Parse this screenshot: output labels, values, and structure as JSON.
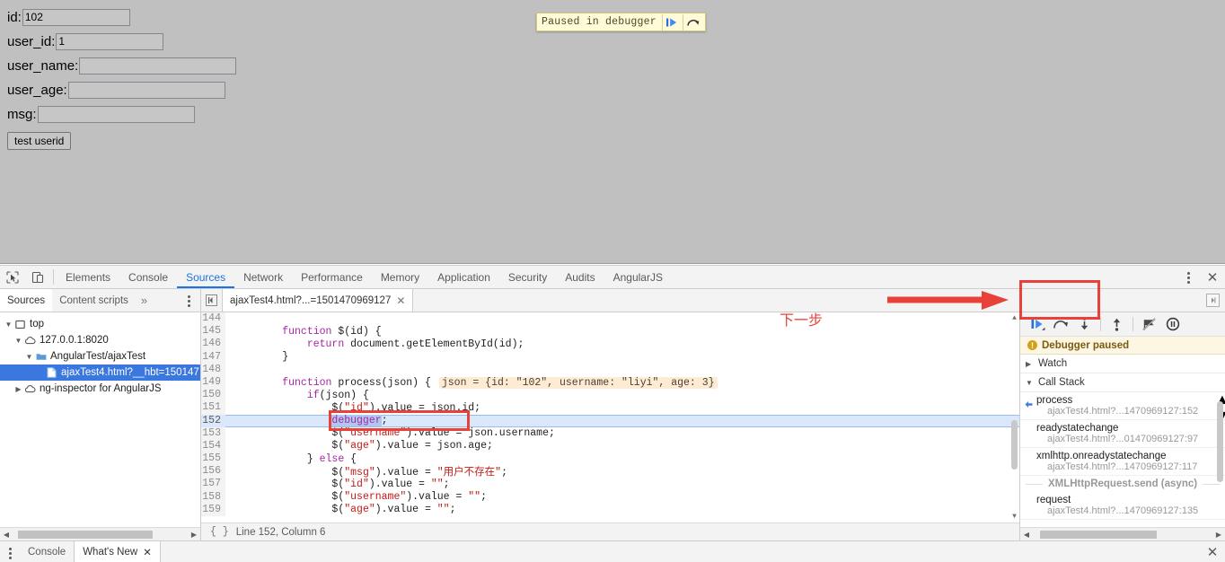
{
  "page": {
    "fields": [
      {
        "label": "id:",
        "value": "102",
        "name": "id-field",
        "width": "w-id"
      },
      {
        "label": "user_id:",
        "value": "1",
        "name": "user-id-field",
        "width": "w-uid"
      },
      {
        "label": "user_name:",
        "value": "",
        "name": "user-name-field",
        "width": "w-uname"
      },
      {
        "label": "user_age:",
        "value": "",
        "name": "user-age-field",
        "width": "w-uage"
      },
      {
        "label": "msg:",
        "value": "",
        "name": "msg-field",
        "width": "w-msg"
      }
    ],
    "test_button": "test userid",
    "pause_banner": {
      "text": "Paused in debugger",
      "resume_icon": "resume-play-icon",
      "step_over_icon": "step-over-icon"
    }
  },
  "devtools": {
    "toolbar": {
      "inspect_icon": "inspect-element-icon",
      "device_icon": "device-toolbar-icon",
      "tabs": [
        {
          "label": "Elements",
          "active": false
        },
        {
          "label": "Console",
          "active": false
        },
        {
          "label": "Sources",
          "active": true
        },
        {
          "label": "Network",
          "active": false
        },
        {
          "label": "Performance",
          "active": false
        },
        {
          "label": "Memory",
          "active": false
        },
        {
          "label": "Application",
          "active": false
        },
        {
          "label": "Security",
          "active": false
        },
        {
          "label": "Audits",
          "active": false
        },
        {
          "label": "AngularJS",
          "active": false
        }
      ],
      "kebab_icon": "more-options-icon",
      "close_icon": "close-devtools-icon"
    },
    "sources_subbar": {
      "nav_tabs": [
        {
          "label": "Sources",
          "active": true
        },
        {
          "label": "Content scripts",
          "active": false
        }
      ],
      "more_tabs_icon": "more-tabs-chevron-icon",
      "nav_kebab_icon": "navigator-more-options-icon",
      "sidebar_toggle_icon": "show-navigator-icon",
      "file_tab": "ajaxTest4.html?...=1501470969127",
      "file_tab_close_icon": "close-tab-icon",
      "expand_sidebar_icon": "expand-debugger-sidebar-icon"
    },
    "navigator": {
      "tree": [
        {
          "indent": 0,
          "twisty": "▼",
          "icon": "frame-icon",
          "label": "top",
          "selected": false
        },
        {
          "indent": 1,
          "twisty": "▼",
          "icon": "cloud-icon",
          "label": "127.0.0.1:8020",
          "selected": false
        },
        {
          "indent": 2,
          "twisty": "▼",
          "icon": "folder-icon",
          "label": "AngularTest/ajaxTest",
          "selected": false
        },
        {
          "indent": 3,
          "twisty": "",
          "icon": "file-icon",
          "label": "ajaxTest4.html?__hbt=150147",
          "selected": true
        },
        {
          "indent": 1,
          "twisty": "▶",
          "icon": "cloud-icon",
          "label": "ng-inspector for AngularJS",
          "selected": false
        }
      ]
    },
    "editor": {
      "lines": [
        {
          "num": "144",
          "exec": false,
          "tokens": []
        },
        {
          "num": "145",
          "exec": false,
          "tokens": [
            {
              "t": "        ",
              "c": ""
            },
            {
              "t": "function",
              "c": "kw"
            },
            {
              "t": " $(id) {",
              "c": ""
            }
          ]
        },
        {
          "num": "146",
          "exec": false,
          "tokens": [
            {
              "t": "            ",
              "c": ""
            },
            {
              "t": "return",
              "c": "kw"
            },
            {
              "t": " document.getElementById(id);",
              "c": ""
            }
          ]
        },
        {
          "num": "147",
          "exec": false,
          "tokens": [
            {
              "t": "        }",
              "c": ""
            }
          ]
        },
        {
          "num": "148",
          "exec": false,
          "tokens": []
        },
        {
          "num": "149",
          "exec": false,
          "tokens": [
            {
              "t": "        ",
              "c": ""
            },
            {
              "t": "function",
              "c": "kw"
            },
            {
              "t": " process(json) {",
              "c": ""
            }
          ],
          "hint": "json = {id: \"102\", username: \"liyi\", age: 3}"
        },
        {
          "num": "150",
          "exec": false,
          "tokens": [
            {
              "t": "            ",
              "c": ""
            },
            {
              "t": "if",
              "c": "kw"
            },
            {
              "t": "(json) {",
              "c": ""
            }
          ]
        },
        {
          "num": "151",
          "exec": false,
          "tokens": [
            {
              "t": "                $(",
              "c": ""
            },
            {
              "t": "\"id\"",
              "c": "str"
            },
            {
              "t": ").value = json.id;",
              "c": ""
            }
          ]
        },
        {
          "num": "152",
          "exec": true,
          "tokens": [
            {
              "t": "                ",
              "c": ""
            },
            {
              "t": "debugger",
              "c": "kw sel"
            },
            {
              "t": ";",
              "c": ""
            }
          ]
        },
        {
          "num": "153",
          "exec": false,
          "tokens": [
            {
              "t": "                $(",
              "c": ""
            },
            {
              "t": "\"username\"",
              "c": "str"
            },
            {
              "t": ").value = json.username;",
              "c": ""
            }
          ]
        },
        {
          "num": "154",
          "exec": false,
          "tokens": [
            {
              "t": "                $(",
              "c": ""
            },
            {
              "t": "\"age\"",
              "c": "str"
            },
            {
              "t": ").value = json.age;",
              "c": ""
            }
          ]
        },
        {
          "num": "155",
          "exec": false,
          "tokens": [
            {
              "t": "            } ",
              "c": ""
            },
            {
              "t": "else",
              "c": "kw"
            },
            {
              "t": " {",
              "c": ""
            }
          ]
        },
        {
          "num": "156",
          "exec": false,
          "tokens": [
            {
              "t": "                $(",
              "c": ""
            },
            {
              "t": "\"msg\"",
              "c": "str"
            },
            {
              "t": ").value = ",
              "c": ""
            },
            {
              "t": "\"用户不存在\"",
              "c": "str"
            },
            {
              "t": ";",
              "c": ""
            }
          ]
        },
        {
          "num": "157",
          "exec": false,
          "tokens": [
            {
              "t": "                $(",
              "c": ""
            },
            {
              "t": "\"id\"",
              "c": "str"
            },
            {
              "t": ").value = ",
              "c": ""
            },
            {
              "t": "\"\"",
              "c": "str"
            },
            {
              "t": ";",
              "c": ""
            }
          ]
        },
        {
          "num": "158",
          "exec": false,
          "tokens": [
            {
              "t": "                $(",
              "c": ""
            },
            {
              "t": "\"username\"",
              "c": "str"
            },
            {
              "t": ").value = ",
              "c": ""
            },
            {
              "t": "\"\"",
              "c": "str"
            },
            {
              "t": ";",
              "c": ""
            }
          ]
        },
        {
          "num": "159",
          "exec": false,
          "tokens": [
            {
              "t": "                $(",
              "c": ""
            },
            {
              "t": "\"age\"",
              "c": "str"
            },
            {
              "t": ").value = ",
              "c": ""
            },
            {
              "t": "\"\"",
              "c": "str"
            },
            {
              "t": ";",
              "c": ""
            }
          ]
        }
      ],
      "status": {
        "pretty_print_icon": "pretty-print-braces-icon",
        "position": "Line 152, Column 6"
      }
    },
    "debugger_pane": {
      "toolbar_buttons": [
        {
          "name": "resume-script-button",
          "icon": "resume-play-icon"
        },
        {
          "name": "step-over-button",
          "icon": "step-over-icon"
        },
        {
          "name": "step-into-button",
          "icon": "step-into-icon"
        },
        {
          "name": "step-out-button",
          "icon": "step-out-icon"
        },
        {
          "name": "deactivate-breakpoints-button",
          "icon": "deactivate-breakpoints-icon"
        },
        {
          "name": "pause-on-exceptions-button",
          "icon": "pause-on-exceptions-icon"
        }
      ],
      "paused_message": "Debugger paused",
      "sections": [
        {
          "label": "Watch",
          "expanded": false,
          "twisty": "▶"
        },
        {
          "label": "Call Stack",
          "expanded": true,
          "twisty": "▼"
        }
      ],
      "call_stack": [
        {
          "name": "process",
          "location": "ajaxTest4.html?...1470969127:152",
          "current": true,
          "async": false
        },
        {
          "name": "readystatechange",
          "location": "ajaxTest4.html?...01470969127:97",
          "current": false,
          "async": false
        },
        {
          "name": "xmlhttp.onreadystatechange",
          "location": "ajaxTest4.html?...1470969127:117",
          "current": false,
          "async": false
        },
        {
          "name": "XMLHttpRequest.send (async)",
          "location": "",
          "current": false,
          "async": true
        },
        {
          "name": "request",
          "location": "ajaxTest4.html?...1470969127:135",
          "current": false,
          "async": false
        }
      ]
    },
    "drawer": {
      "kebab_icon": "drawer-more-options-icon",
      "tabs": [
        {
          "label": "Console",
          "active": false,
          "closable": false
        },
        {
          "label": "What's New",
          "active": true,
          "closable": true
        }
      ],
      "close_icon": "close-drawer-icon"
    }
  },
  "annotations": {
    "next_step_text": "下一步",
    "arrow_color": "#e8413a",
    "box_color": "#e8413a"
  }
}
